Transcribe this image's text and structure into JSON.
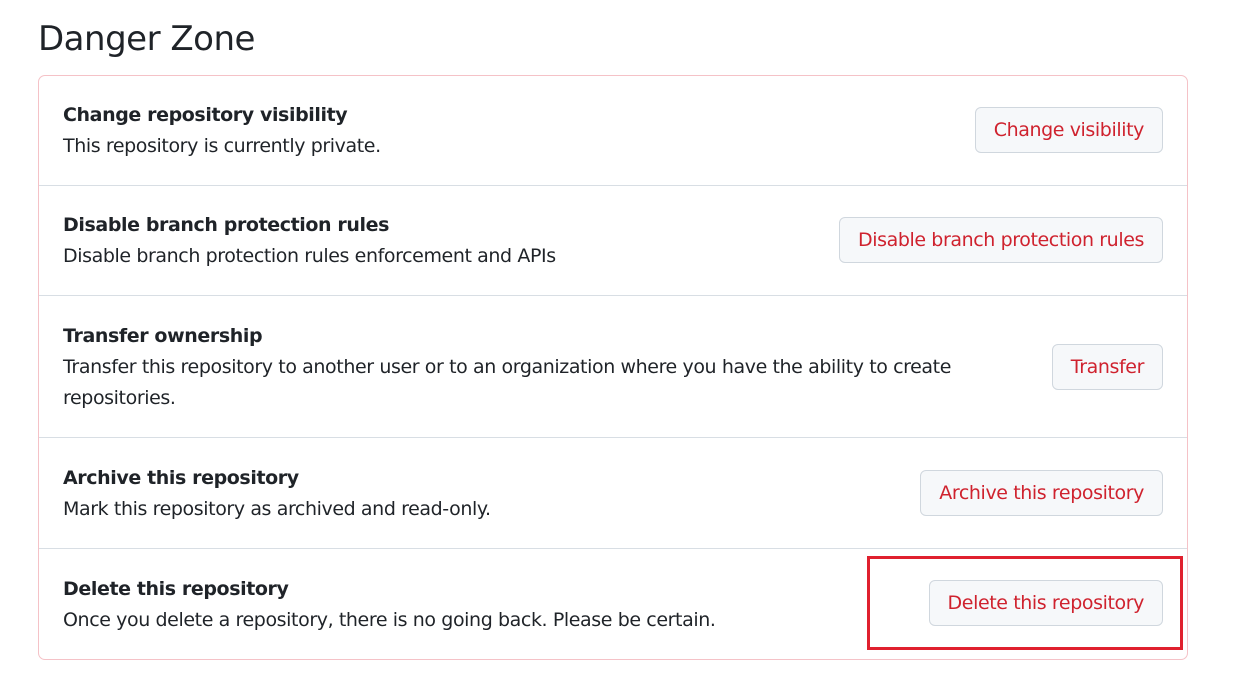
{
  "page": {
    "title": "Danger Zone"
  },
  "danger_zone": {
    "rows": [
      {
        "title": "Change repository visibility",
        "description": "This repository is currently private.",
        "button_label": "Change visibility"
      },
      {
        "title": "Disable branch protection rules",
        "description": "Disable branch protection rules enforcement and APIs",
        "button_label": "Disable branch protection rules"
      },
      {
        "title": "Transfer ownership",
        "description_line1": "Transfer this repository to another user or to an organization where you have the ability to create",
        "description_line2": "repositories.",
        "button_label": "Transfer"
      },
      {
        "title": "Archive this repository",
        "description": "Mark this repository as archived and read-only.",
        "button_label": "Archive this repository"
      },
      {
        "title": "Delete this repository",
        "description": "Once you delete a repository, there is no going back. Please be certain.",
        "button_label": "Delete this repository"
      }
    ]
  },
  "colors": {
    "danger_text": "#cf222e",
    "danger_border": "#f5c2c7",
    "highlight": "#e0202e",
    "button_bg": "#f6f8fa"
  }
}
